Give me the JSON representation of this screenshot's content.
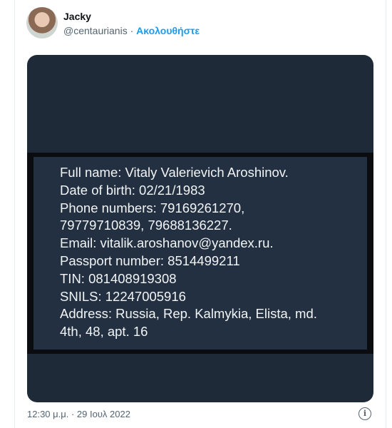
{
  "tweet": {
    "author_name": "Jacky",
    "author_handle": "@centaurianis",
    "separator": "·",
    "follow_label": "Ακολουθήστε",
    "timestamp": "12:30 μ.μ. · 29 Ιουλ 2022",
    "info_icon_glyph": "i"
  },
  "image": {
    "lines": [
      "Full name: Vitaly Valerievich Aroshinov.",
      "Date of birth: 02/21/1983",
      "Phone numbers: 79169261270,",
      "79779710839, 79688136227.",
      "Email: vitalik.aroshanov@yandex.ru.",
      "Passport number: 8514499211",
      "TIN: 081408919308",
      "SNILS: 12247005916",
      "Address: Russia, Rep. Kalmykia, Elista, md.",
      "4th, 48, apt. 16"
    ]
  },
  "colors": {
    "accent": "#1d9bf0",
    "media_bg": "#1e2a38",
    "panel_bg": "#223041"
  },
  "icons": [
    "avatar",
    "info-icon"
  ]
}
